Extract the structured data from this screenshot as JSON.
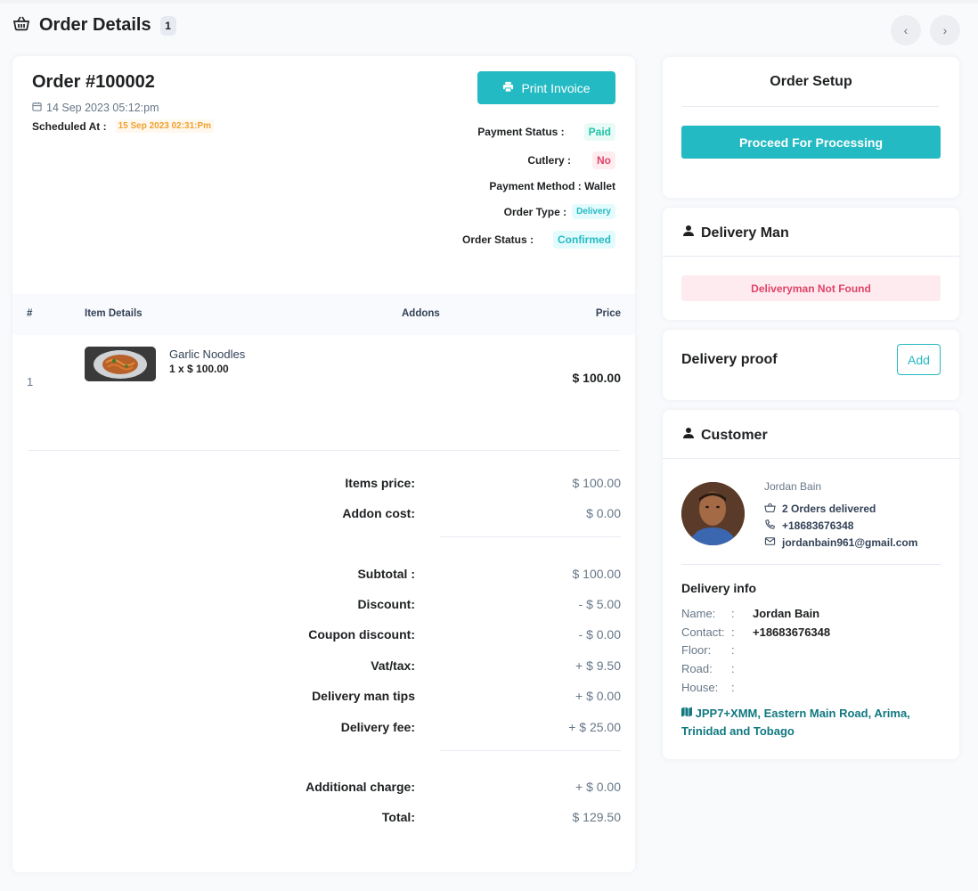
{
  "header": {
    "title": "Order Details",
    "badge": "1",
    "prev_icon": "chevron-left-icon",
    "next_icon": "chevron-right-icon"
  },
  "order": {
    "number": "Order #100002",
    "date": "14 Sep 2023 05:12:pm",
    "scheduled_label": "Scheduled At :",
    "scheduled_value": "15 Sep 2023 02:31:Pm",
    "print_label": "Print Invoice",
    "status": {
      "payment_status_label": "Payment Status :",
      "payment_status_value": "Paid",
      "cutlery_label": "Cutlery :",
      "cutlery_value": "No",
      "payment_method": "Payment Method : Wallet",
      "order_type_label": "Order Type :",
      "order_type_value": "Delivery",
      "order_status_label": "Order Status :",
      "order_status_value": "Confirmed"
    }
  },
  "table": {
    "columns": [
      "#",
      "Item Details",
      "Addons",
      "Price"
    ],
    "items": [
      {
        "index": "1",
        "name": "Garlic Noodles",
        "qty": "1 x $ 100.00",
        "price": "$ 100.00"
      }
    ]
  },
  "summary": [
    {
      "label": "Items price:",
      "value": "$ 100.00"
    },
    {
      "label": "Addon cost:",
      "value": "$ 0.00"
    },
    {
      "label": "Subtotal :",
      "value": "$ 100.00"
    },
    {
      "label": "Discount:",
      "value": "- $ 5.00"
    },
    {
      "label": "Coupon discount:",
      "value": "- $ 0.00"
    },
    {
      "label": "Vat/tax:",
      "value": "+ $ 9.50"
    },
    {
      "label": "Delivery man tips",
      "value": "+ $ 0.00"
    },
    {
      "label": "Delivery fee:",
      "value": "+ $ 25.00"
    },
    {
      "label": "Additional charge:",
      "value": "+ $ 0.00"
    },
    {
      "label": "Total:",
      "value": "$ 129.50"
    }
  ],
  "setup": {
    "title": "Order Setup",
    "proceed_label": "Proceed For Processing"
  },
  "delivery_man": {
    "title": "Delivery Man",
    "alert": "Deliveryman Not Found"
  },
  "delivery_proof": {
    "title": "Delivery proof",
    "add_label": "Add"
  },
  "customer": {
    "title": "Customer",
    "name": "Jordan Bain",
    "orders_delivered": "2 Orders delivered",
    "phone": "+18683676348",
    "email": "jordanbain961@gmail.com",
    "delivery_info": {
      "title": "Delivery info",
      "rows": [
        {
          "label": "Name:",
          "value": "Jordan Bain"
        },
        {
          "label": "Contact:",
          "value": "+18683676348"
        },
        {
          "label": "Floor:",
          "value": ""
        },
        {
          "label": "Road:",
          "value": ""
        },
        {
          "label": "House:",
          "value": ""
        }
      ],
      "address": "JPP7+XMM, Eastern Main Road, Arima, Trinidad and Tobago"
    }
  },
  "colors": {
    "accent": "#24bac3",
    "danger": "#e04468",
    "scheduled": "#f0a130",
    "address": "#107980"
  }
}
